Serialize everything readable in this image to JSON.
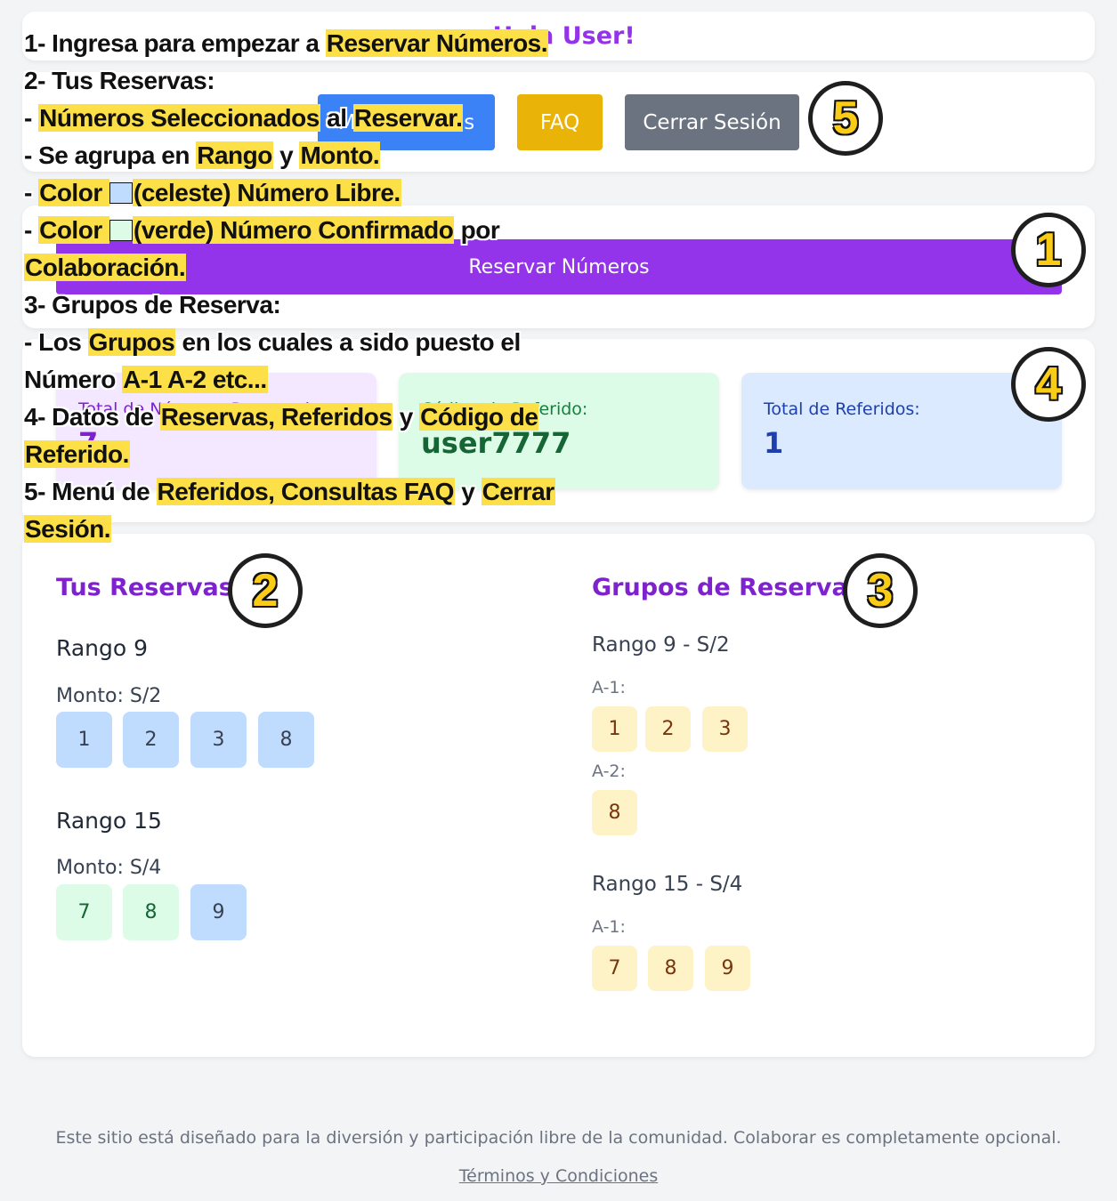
{
  "greeting": "¡Hola User!",
  "menu": {
    "referidos": "Mis Referidos",
    "faq": "FAQ",
    "logout": "Cerrar Sesión"
  },
  "reserve_button": "Reservar Números",
  "stats": {
    "total_label": "Total de Números Reservados:",
    "total_value": "7",
    "code_label": "Código de Referido:",
    "code_value": "user7777",
    "referrals_label": "Total de Referidos:",
    "referrals_value": "1"
  },
  "reservas": {
    "title": "Tus Reservas",
    "rangos": [
      {
        "title": "Rango 9",
        "monto": "Monto: S/2",
        "numbers": [
          "1",
          "2",
          "3",
          "8"
        ]
      },
      {
        "title": "Rango 15",
        "monto": "Monto: S/4",
        "numbers": [
          "7",
          "8",
          "9"
        ]
      }
    ]
  },
  "grupos": {
    "title": "Grupos de Reserva",
    "rangos": [
      {
        "title": "Rango 9 - S/2",
        "groups": [
          {
            "label": "A-1:",
            "numbers": [
              "1",
              "2",
              "3"
            ]
          },
          {
            "label": "A-2:",
            "numbers": [
              "8"
            ]
          }
        ]
      },
      {
        "title": "Rango 15 - S/4",
        "groups": [
          {
            "label": "A-1:",
            "numbers": [
              "7",
              "8",
              "9"
            ]
          }
        ]
      }
    ]
  },
  "footer": {
    "text": "Este sitio está diseñado para la diversión y participación libre de la comunidad. Colaborar es completamente opcional.",
    "link": "Términos y Condiciones"
  },
  "overlay": {
    "l1a": "1- Ingresa para empezar a ",
    "l1b": "Reservar Números.",
    "l2": "2- Tus Reservas:",
    "l3a": " - ",
    "l3b": "Números Seleccionados",
    "l3c": " al ",
    "l3d": "Reservar.",
    "l4a": " - Se agrupa en ",
    "l4b": "Rango",
    "l4c": " y ",
    "l4d": "Monto.",
    "l5a": " - ",
    "l5b": "Color ",
    "l5c": "(celeste) Número Libre.",
    "l6a": " - ",
    "l6b": "Color ",
    "l6c": "(verde) Número Confirmado",
    "l6d": " por",
    "l7": "Colaboración.",
    "l8": "3- Grupos de Reserva:",
    "l9a": " - Los ",
    "l9b": "Grupos",
    "l9c": " en los cuales a sido puesto el",
    "l10a": "Número ",
    "l10b": "A-1 A-2 etc...",
    "l11a": "4- Datos de ",
    "l11b": "Reservas, Referidos",
    "l11c": " y ",
    "l11d": "Código de",
    "l12": "Referido.",
    "l13a": "5- Menú de ",
    "l13b": "Referidos, Consultas FAQ",
    "l13c": " y ",
    "l13d": "Cerrar",
    "l14": "Sesión.",
    "badges": [
      "1",
      "2",
      "3",
      "4",
      "5"
    ]
  }
}
